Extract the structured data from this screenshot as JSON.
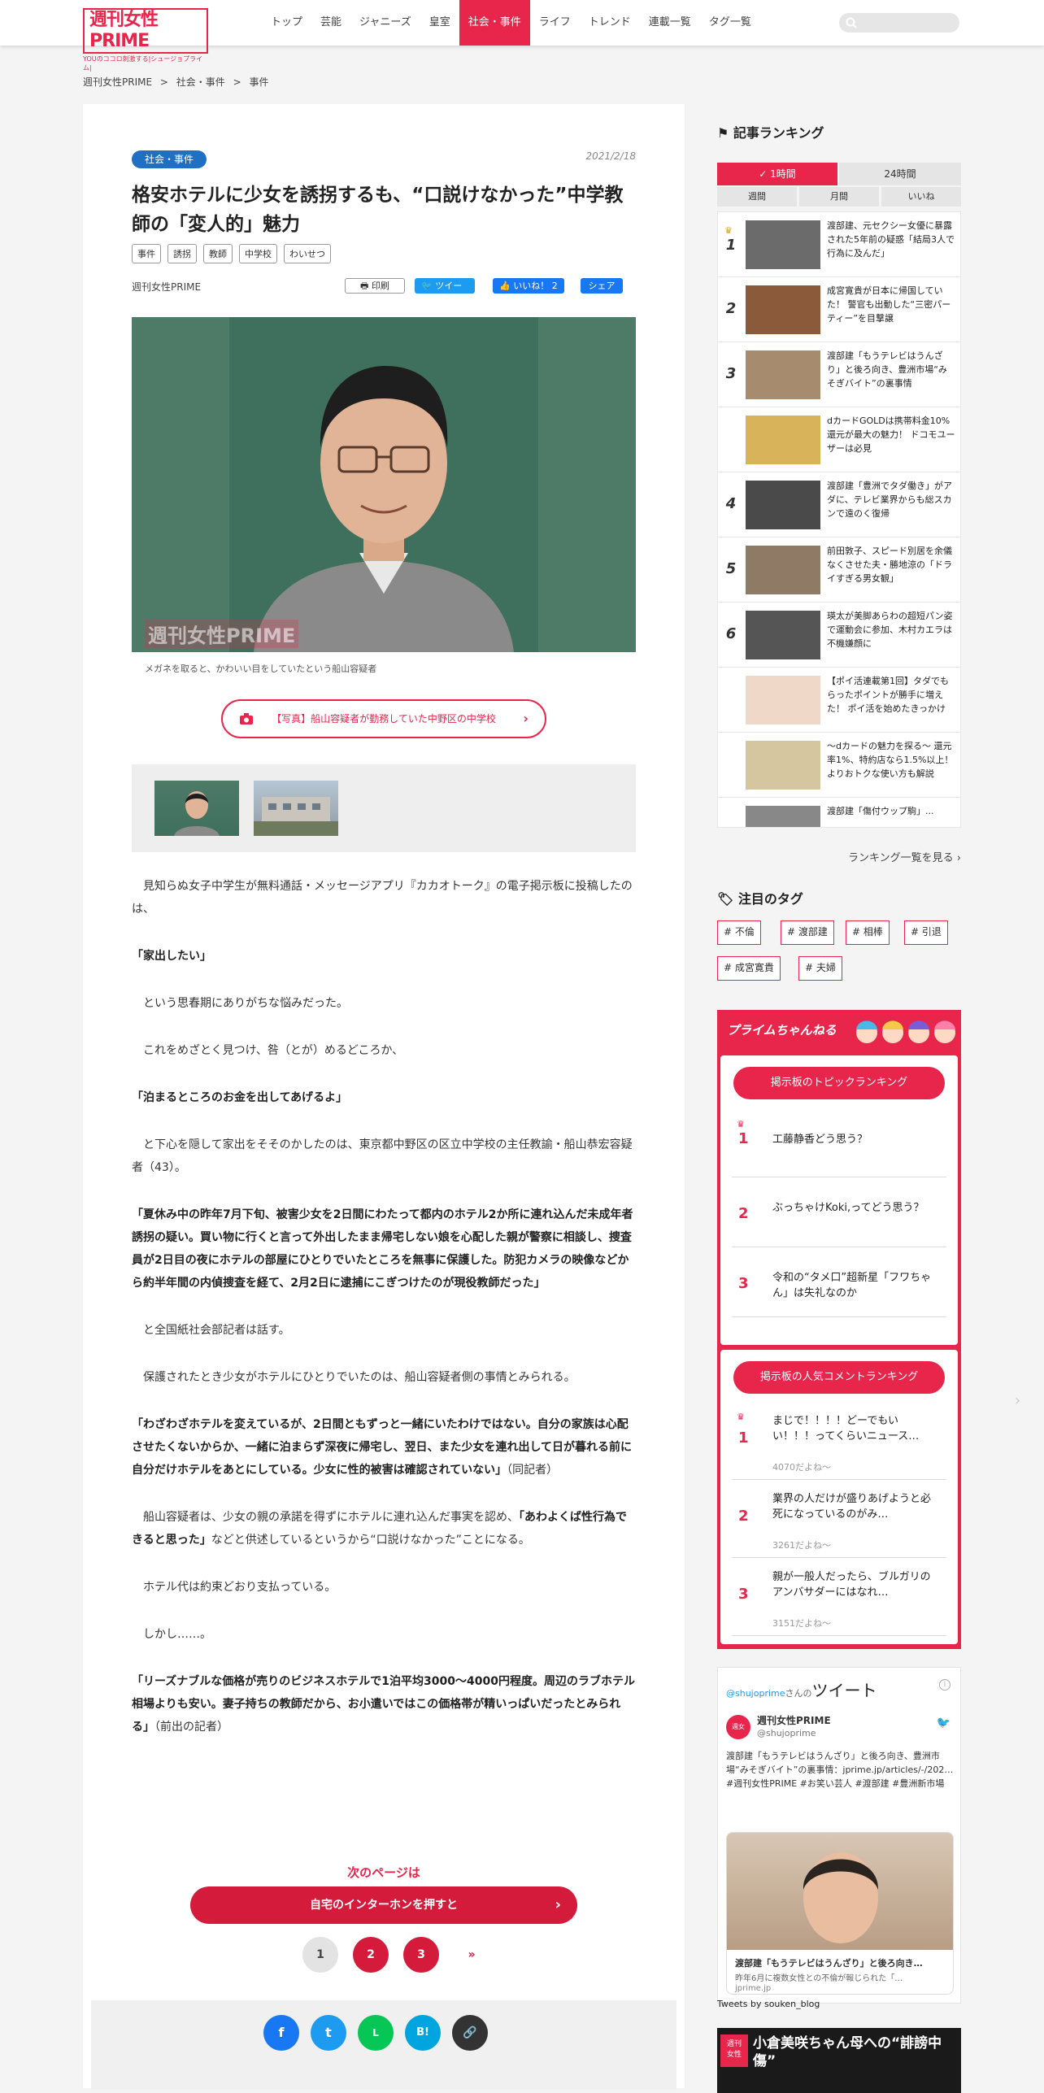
{
  "header": {
    "logo": "週刊女性PRIME",
    "logo_sub": "YOUのココロ刺激する|シュージョプライム|",
    "nav": [
      "トップ",
      "芸能",
      "ジャニーズ",
      "皇室",
      "社会・事件",
      "ライフ",
      "トレンド",
      "連載一覧",
      "タグ一覧"
    ],
    "active_index": 4,
    "search_placeholder": ""
  },
  "breadcrumb": [
    "週刊女性PRIME",
    ">",
    "社会・事件",
    ">",
    "事件"
  ],
  "article": {
    "category": "社会・事件",
    "date": "2021/2/18",
    "title": "格安ホテルに少女を誘拐するも、“口説けなかった”中学教師の「変人的」魅力",
    "tags": [
      "事件",
      "誘拐",
      "教師",
      "中学校",
      "わいせつ"
    ],
    "author": "週刊女性PRIME",
    "share": {
      "print": "印刷",
      "tweet": "ツイート",
      "like": "いいね！ 2",
      "fb_share": "シェア"
    },
    "photo_watermark": "週刊女性PRIME",
    "caption": "メガネを取ると、かわいい目をしていたという船山容疑者",
    "photo_button": "【写真】船山容疑者が勤務していた中野区の中学校",
    "paragraphs": [
      {
        "t": "見知らぬ女子中学生が無料通話・メッセージアプリ『カカオトーク』の電子掲示板に投稿したのは、",
        "b": false
      },
      {
        "t": "「家出したい」",
        "b": true
      },
      {
        "t": "という思春期にありがちな悩みだった。",
        "b": false
      },
      {
        "t": "これをめざとく見つけ、咎（とが）めるどころか、",
        "b": false
      },
      {
        "t": "「泊まるところのお金を出してあげるよ」",
        "b": true
      },
      {
        "t": "と下心を隠して家出をそそのかしたのは、東京都中野区の区立中学校の主任教諭・船山恭宏容疑者（43）。",
        "b": false
      },
      {
        "t": "「夏休み中の昨年7月下旬、被害少女を2日間にわたって都内のホテル2か所に連れ込んだ未成年者誘拐の疑い。買い物に行くと言って外出したまま帰宅しない娘を心配した親が警察に相談し、捜査員が2日目の夜にホテルの部屋にひとりでいたところを無事に保護した。防犯カメラの映像などから約半年間の内偵捜査を経て、2月2日に逮捕にこぎつけたのが現役教師だった」",
        "b": true
      },
      {
        "t": "と全国紙社会部記者は話す。",
        "b": false
      },
      {
        "t": "保護されたとき少女がホテルにひとりでいたのは、船山容疑者側の事情とみられる。",
        "b": false
      },
      {
        "t": "「わざわざホテルを変えているが、2日間ともずっと一緒にいたわけではない。自分の家族は心配させたくないからか、一緒に泊まらず深夜に帰宅し、翌日、また少女を連れ出して日が暮れる前に自分だけホテルをあとにしている。少女に性的被害は確認されていない」",
        "s": "（同記者）",
        "b": true
      },
      {
        "t": "船山容疑者は、少女の親の承諾を得ずにホテルに連れ込んだ事実を認め、",
        "x": "「あわよくば性行為できると思った」",
        "y": "などと供述しているというから“口説けなかった”ことになる。",
        "b": false,
        "mixed": true
      },
      {
        "t": "ホテル代は約束どおり支払っている。",
        "b": false
      },
      {
        "t": "しかし……。",
        "b": false
      },
      {
        "t": "「リーズナブルな価格が売りのビジネスホテルで1泊平均3000～4000円程度。周辺のラブホテル相場よりも安い。妻子持ちの教師だから、お小遣いではこの価格帯が精いっぱいだったとみられる」",
        "s": "（前出の記者）",
        "b": true
      }
    ],
    "next_label": "次のページは",
    "next_title": "自宅のインターホンを押すと",
    "pages": [
      "1",
      "2",
      "3",
      "»"
    ],
    "footer_share": [
      "f",
      "t",
      "L",
      "B!",
      "🔗"
    ]
  },
  "sidebar": {
    "ranking_title": "記事ランキング",
    "tabs": [
      "1時間",
      "24時間"
    ],
    "subtabs": [
      "週間",
      "月間",
      "いいね"
    ],
    "items": [
      {
        "n": "1",
        "t": "渡部建、元セクシー女優に暴露された5年前の疑惑「結局3人で行為に及んだ」"
      },
      {
        "n": "2",
        "t": "成宮寛貴が日本に帰国していた！ 警官も出動した“三密パーティー”を目撃譲"
      },
      {
        "n": "3",
        "t": "渡部建「もうテレビはうんざり」と後ろ向き、豊洲市場“みそぎバイト”の裏事情"
      },
      {
        "n": "",
        "t": "dカードGOLDは携帯料金10%還元が最大の魅力！ ドコモユーザーは必見"
      },
      {
        "n": "4",
        "t": "渡部建「豊洲でタダ働き」がアダに、テレビ業界からも総スカンで遠のく復帰"
      },
      {
        "n": "5",
        "t": "前田敦子、スピード別居を余儀なくさせた夫・勝地涼の「ドライすぎる男女観」"
      },
      {
        "n": "6",
        "t": "瑛太が美脚あらわの超短パン姿で運動会に参加、木村カエラは不機嫌顔に"
      },
      {
        "n": "",
        "t": "【ポイ活連載第1回】タダでもらったポイントが勝手に増えた！ ポイ活を始めたきっかけ"
      },
      {
        "n": "",
        "t": "〜dカードの魅力を探る〜 還元率1%、特約店なら1.5%以上！ よりおトクな使い方も解説"
      },
      {
        "n": "",
        "t": "渡部建「傷付ウップ駒」..."
      }
    ],
    "ranking_more": "ランキング一覧を見る",
    "tags_title": "注目のタグ",
    "hot_tags": [
      "# 不倫",
      "# 渡部建",
      "# 相棒",
      "# 引退",
      "# 成宮寛貴",
      "# 夫婦"
    ],
    "channel": {
      "title": "プライムちゃんねる",
      "topic_label": "掲示板のトピックランキング",
      "topics": [
        {
          "n": "1",
          "t": "工藤静香どう思う？"
        },
        {
          "n": "2",
          "t": "ぶっちゃけKoki,ってどう思う？"
        },
        {
          "n": "3",
          "t": "令和の“タメ口”超新星「フワちゃん」は失礼なのか"
        }
      ],
      "comment_label": "掲示板の人気コメントランキング",
      "comments": [
        {
          "n": "1",
          "t": "まじで！！！！どーでもいい！！！ってくらいニュース…",
          "l": "4070だよね〜"
        },
        {
          "n": "2",
          "t": "業界の人だけが盛りあげようと必死になっているのがみ…",
          "l": "3261だよね〜"
        },
        {
          "n": "3",
          "t": "親が一般人だったら、ブルガリのアンバサダーにはなれ…",
          "l": "3151だよね〜"
        }
      ]
    },
    "twitter": {
      "handle": "@shujoprime",
      "suffix": "さんの",
      "title": "ツイート",
      "name": "週刊女性PRIME",
      "user": "@shujoprime",
      "text": "渡部建「もうテレビはうんざり」と後ろ向き、豊洲市場“みそぎバイト”の裏事情：jprime.jp/articles/-/202… #週刊女性PRIME #お笑い芸人 #渡部建 #豊洲新市場",
      "card_title": "渡部建「もうテレビはうんざり」と後ろ向き…",
      "card_desc": "昨年6月に複数女性との不倫が報じられた「…",
      "card_domain": "jprime.jp",
      "footer": "Tweets by souken_blog"
    },
    "video_text": "小倉美咲ちゃん母への“誹謗中傷”"
  },
  "colors": {
    "brand": "#e8264b",
    "category_badge": "#1f6fc5"
  }
}
